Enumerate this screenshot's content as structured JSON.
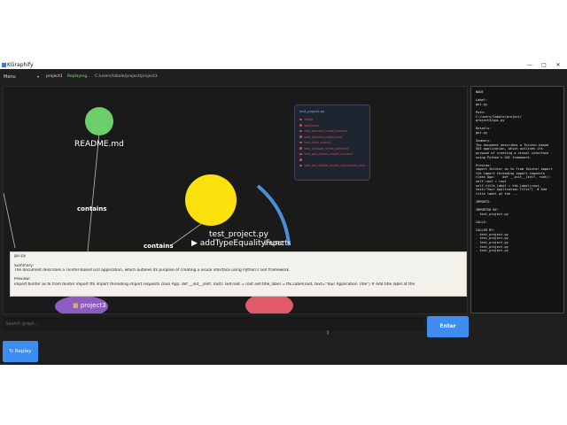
{
  "window": {
    "title": "KGraphify",
    "minimize_glyph": "—",
    "maximize_glyph": "□",
    "close_glyph": "✕"
  },
  "toolbar": {
    "menu_label": "Menu",
    "menu_arrow": "▾",
    "project_name": "project3",
    "status": "Replaying...",
    "path": "C:/users/labale/project/project3"
  },
  "graph": {
    "nodes": {
      "readme": {
        "label": "README.md",
        "color": "#6ccf6c"
      },
      "test_project": {
        "label": "test_project.py",
        "color": "#fbe10e"
      },
      "project3": {
        "label": "project3",
        "color": "#8c5cc2"
      },
      "lower": {
        "color": "#e05a6a"
      }
    },
    "type_hint": "▶ addTypeEqualityFunc",
    "overlap_text": "imports",
    "edge_labels": [
      "contains",
      "contains"
    ],
    "legend": {
      "title": "test_project.py",
      "items": [
        "setUp",
        "tearDown",
        "test_process_model_success",
        "test_process_model_error",
        "test_clear_output",
        "test_validate_model_different",
        "test_get_ollama_model_success",
        "",
        "test_get_ollama_model_connection_error"
      ]
    },
    "colors": {
      "edge": "#bcbcbc",
      "import_edge": "#4a90d9",
      "background": "#1a1a1a"
    }
  },
  "popup": {
    "filename": "gui.py",
    "summary_label": "Summary:",
    "summary": "The document describes a Tkinter-based GUI application, which outlines its purpose of creating a visual interface using Python's GUI framework.",
    "preview_label": "Preview:",
    "preview": "import tkinter as tk from tkinter import ttk import threading import requests class App: def __init__(self, root): self.root = root self.title_label = ttk.Label(root, text=\"Your Application Title\") # Add title label at the"
  },
  "details": {
    "lines": [
      "NODE",
      "",
      "Label:",
      "gui.py",
      "",
      "Path:",
      "C:/users/labale/project/",
      "project3/gui.py",
      "",
      "Details:",
      "gui.py",
      "",
      "Summary:",
      "The document describes a Tkinter-based",
      "GUI application, which outlines its",
      "purpose of creating a visual interface",
      "using Python's GUI framework.",
      "",
      "Preview:",
      "import tkinter as tk from tkinter import",
      "ttk import threading import requests",
      "class App:    def __init__(self, root):",
      "self.root = root",
      "self.title_label = ttk.Label(root,",
      "text=\"Your Application Title\")  # Add",
      "title label at the ...",
      "",
      "IMPORTS:",
      "",
      "IMPORTED BY:",
      "- test_project.py",
      "",
      "CALLS:",
      "",
      "CALLED BY:",
      "- test_project.py",
      "- test_project.py",
      "- test_project.py",
      "- test_project.py",
      "- test_project.py"
    ]
  },
  "search": {
    "placeholder": "Search graph..."
  },
  "buttons": {
    "enter": "Enter",
    "replay": "↻ Replay"
  },
  "cursor_glyph": "I"
}
